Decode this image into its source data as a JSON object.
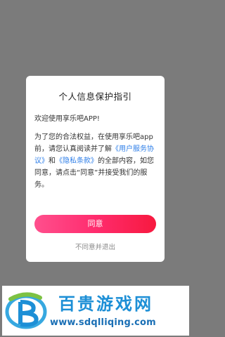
{
  "dialog": {
    "title": "个人信息保护指引",
    "welcome": "欢迎使用享乐吧APP!",
    "body_prefix": "为了您的合法权益，在使用享乐吧app前，请您认真阅读并了解",
    "user_agreement_link": "《用户服务协议》",
    "and_text": "和",
    "privacy_link": "《隐私条款》",
    "body_suffix": "的全部内容，如您同意，请点击“同意”并接受我们的服务。",
    "agree_label": "同意",
    "disagree_label": "不同意并退出"
  },
  "watermark": {
    "site_name": "百贵游戏网",
    "url": "www.sdqlliqing.com"
  },
  "colors": {
    "link": "#2f7fe8",
    "agree_gradient_start": "#ff4f8d",
    "agree_gradient_end": "#f7193f",
    "overlay": "#7b7b7b",
    "watermark_blue": "#1d8fd6"
  }
}
